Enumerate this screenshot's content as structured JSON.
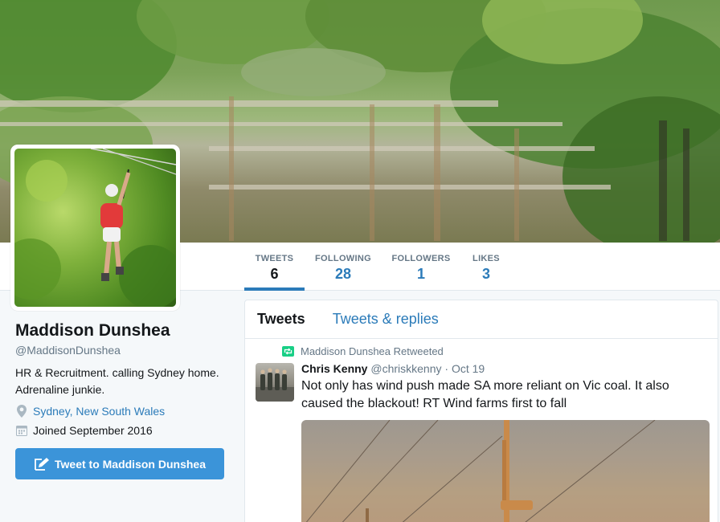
{
  "nav": {
    "stats": [
      {
        "label": "TWEETS",
        "value": "6"
      },
      {
        "label": "FOLLOWING",
        "value": "28"
      },
      {
        "label": "FOLLOWERS",
        "value": "1"
      },
      {
        "label": "LIKES",
        "value": "3"
      }
    ],
    "active_index": 0
  },
  "profile": {
    "name": "Maddison Dunshea",
    "handle": "@MaddisonDunshea",
    "bio": "HR & Recruitment. calling Sydney home. Adrenaline junkie.",
    "location": "Sydney, New South Wales",
    "joined": "Joined September 2016",
    "tweet_to_label": "Tweet to Maddison Dunshea"
  },
  "timeline": {
    "tabs": [
      "Tweets",
      "Tweets & replies"
    ],
    "tweet": {
      "context": "Maddison Dunshea Retweeted",
      "author_name": "Chris Kenny",
      "author_handle": "@chriskkenny",
      "separator": " · ",
      "date": "Oct 19",
      "text": "Not only has wind push made SA more reliant on Vic coal. It also caused the blackout! RT Wind farms first to fall"
    }
  },
  "colors": {
    "accent": "#2b7bb9",
    "button": "#3b94d9",
    "retweet": "#19cf86",
    "muted": "#657786"
  },
  "icons": {
    "location": "map-pin-icon",
    "joined": "calendar-icon",
    "tweet_button": "compose-icon",
    "retweet": "retweet-icon"
  }
}
